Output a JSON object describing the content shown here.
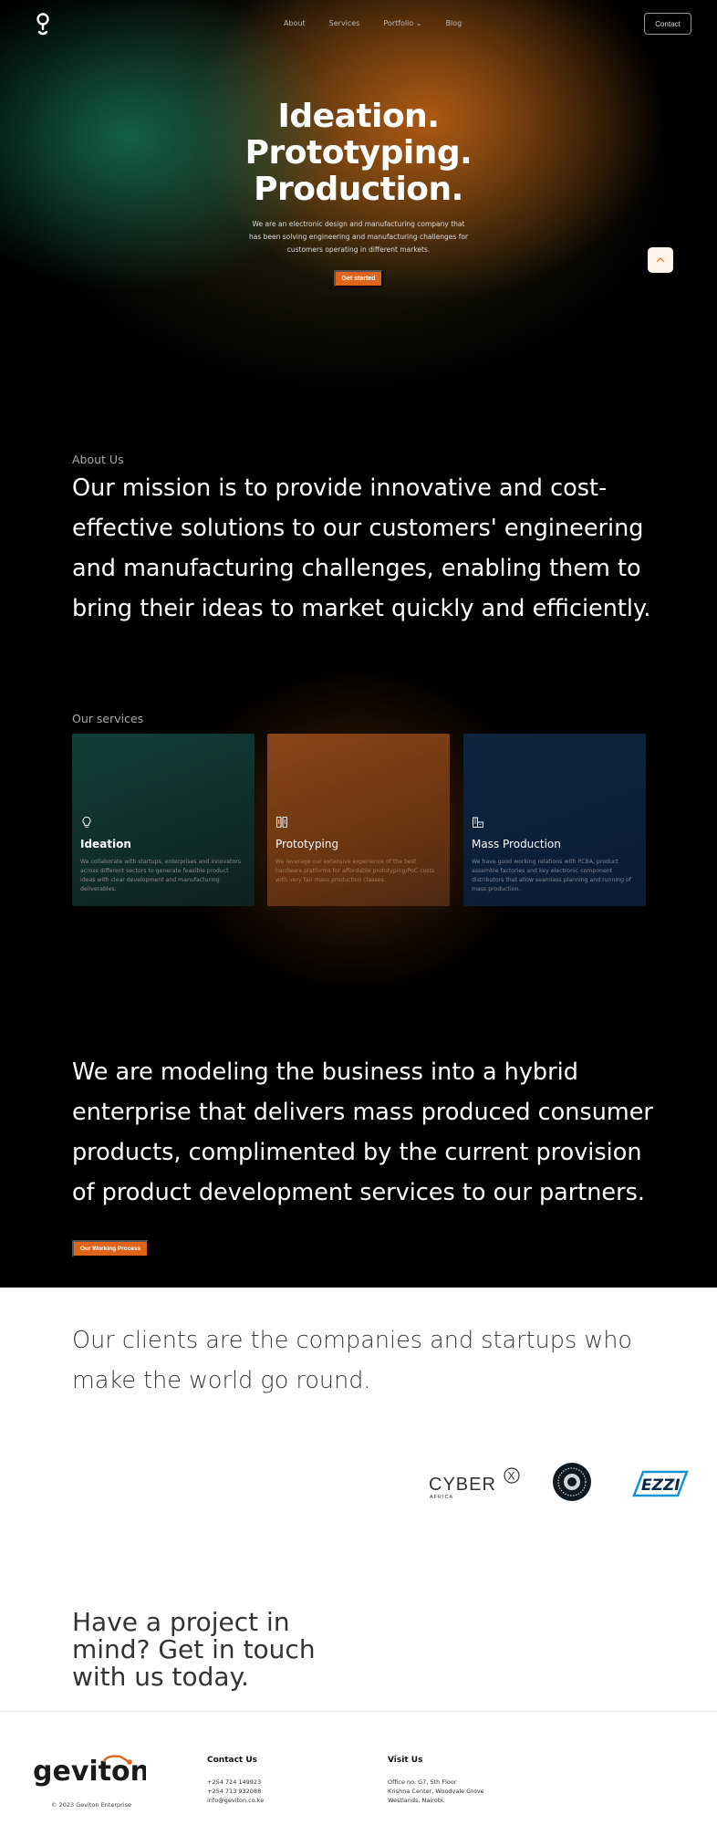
{
  "nav": {
    "items": [
      "About",
      "Services",
      "Portfolio",
      "Blog"
    ],
    "portfolio_caret": "⌄",
    "contact_label": "Contact",
    "logo_icon": "geviton-bulb-icon"
  },
  "hero": {
    "title_lines": [
      "Ideation.",
      "Prototyping.",
      "Production."
    ],
    "subtitle": "We are an electronic design and manufacturing company that has been solving engineering and manufacturing challenges for customers operating in different markets.",
    "cta_label": "Get started",
    "scroll_top_icon": "chevron-up-icon"
  },
  "about": {
    "label": "About Us",
    "text": "Our mission is to provide innovative and cost-effective solutions to our customers' engineering and manufacturing challenges, enabling them to bring their ideas to market quickly and efficiently."
  },
  "services": {
    "label": "Our services",
    "cards": [
      {
        "title": "Ideation",
        "icon": "lightbulb-icon",
        "description": "We collaborate with startups, enterprises and innovators across different sectors to generate feasible product ideas with clear development and manufacturing deliverables."
      },
      {
        "title": "Prototyping",
        "icon": "components-icon",
        "description": "We leverage our extensive experience of the best hardware platforms for affordable prototyping/PoC costs with very fair mass production classes."
      },
      {
        "title": "Mass Production",
        "icon": "factory-icon",
        "description": "We have good working relations with PCBA, product assemble factories and key electronic component distributors that allow seamless planning and running of mass production."
      }
    ]
  },
  "hybrid": {
    "text": "We are modeling the business into a hybrid enterprise that delivers mass produced consumer products, complimented by the current provision of product development services to our partners.",
    "button_label": "Our Working Process"
  },
  "clients": {
    "text": "Our clients are the companies and startups who make the world go round.",
    "logos": [
      {
        "name": "cyberx-africa-logo",
        "text": "CYBER",
        "subtext": "AFRICA",
        "mark": "X"
      },
      {
        "name": "circle-emblem-logo"
      },
      {
        "name": "ezzi-logo",
        "text": "EZZI"
      }
    ]
  },
  "cta": {
    "text": "Have a project in mind? Get in touch with us today."
  },
  "footer": {
    "brand": "geviton",
    "copyright": "© 2023 Geviton Enterprise",
    "contact_heading": "Contact Us",
    "contact_lines": [
      "+254 724 149923",
      "+254 713 932088",
      "info@geviton.co.ke"
    ],
    "visit_heading": "Visit Us",
    "visit_lines": [
      "Office no. G7, 5th Floor",
      "Krishna Center, Woodvale Grove",
      "Westlands, Nairobi."
    ]
  },
  "colors": {
    "accent": "#e0651a",
    "background_dark": "#000000",
    "background_light": "#ffffff"
  }
}
